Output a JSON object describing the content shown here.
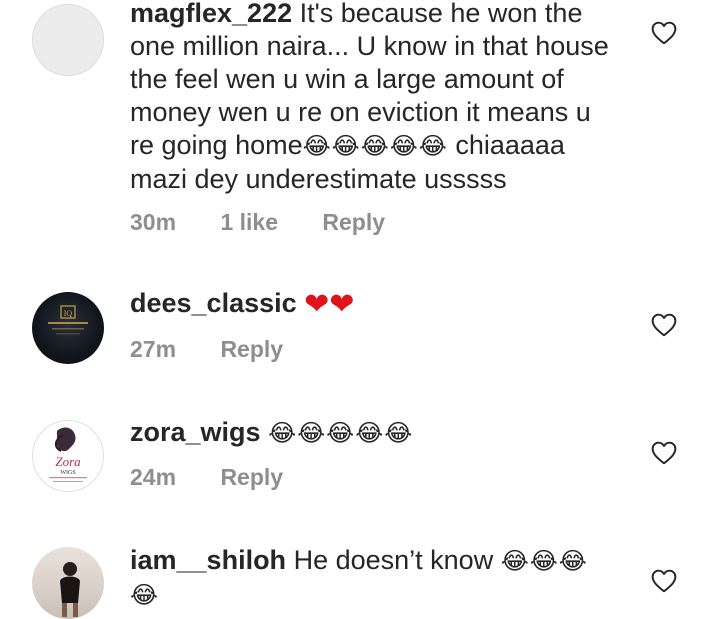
{
  "comments": [
    {
      "username": "magflex_222",
      "text_lines": [
        "It's because he won the",
        "one million naira... U know in that house",
        "the feel wen u win a large amount of",
        "money wen u re on eviction it means u",
        "re going home"
      ],
      "emoji_after": "😂😂😂😂😂",
      "text_tail": " chiaaaaa",
      "last_line": "mazi dey underestimate usssss",
      "time": "30m",
      "likes": "1 like",
      "reply": "Reply"
    },
    {
      "username": "dees_classic",
      "emoji": "❤❤",
      "time": "27m",
      "reply": "Reply",
      "avatar_logo": "IQ"
    },
    {
      "username": "zora_wigs",
      "emoji": "😂😂😂😂😂",
      "time": "24m",
      "reply": "Reply",
      "avatar_brand": "Zora",
      "avatar_sub": "WIGS"
    },
    {
      "username": "iam__shiloh",
      "text": "He doesn’t know",
      "emoji": "😂😂😂",
      "emoji_line2": "😂"
    }
  ],
  "icons": {
    "like": "heart-outline-icon"
  }
}
